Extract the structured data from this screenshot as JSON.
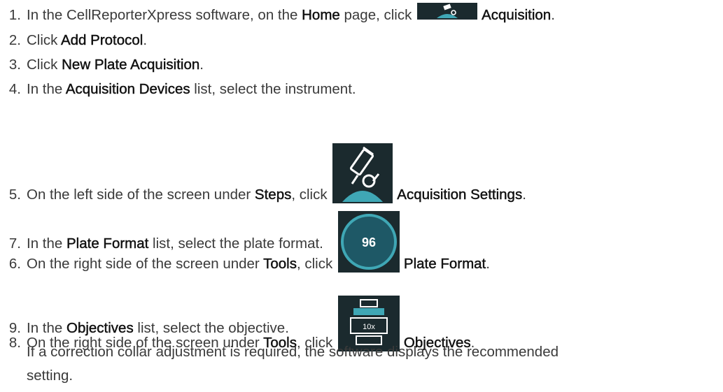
{
  "steps": [
    {
      "num": "1.",
      "pre": "In the CellReporterXpress software, on the ",
      "b1": "Home",
      "mid": " page, click ",
      "b2": "Acquisition",
      "post": ".",
      "icon": "acquisition-icon"
    },
    {
      "num": "2.",
      "pre": "Click ",
      "b1": "Add Protocol",
      "post": "."
    },
    {
      "num": "3.",
      "pre": "Click ",
      "b1": "New Plate Acquisition",
      "post": "."
    },
    {
      "num": "4.",
      "pre": "In the ",
      "b1": "Acquisition Devices",
      "post": " list, select the instrument."
    },
    {
      "num": "5.",
      "pre": "On the left side of the screen under ",
      "b1": "Steps",
      "mid": ", click ",
      "b2": "Acquisition Settings",
      "post": ".",
      "icon": "microscope-icon"
    },
    {
      "num": "6.",
      "pre": "On the right side of the screen under ",
      "b1": "Tools",
      "mid": ", click ",
      "b2": "Plate Format",
      "post": ".",
      "icon": "plate-format-icon",
      "icon_text": "96"
    },
    {
      "num": "7.",
      "pre": "In the ",
      "b1": "Plate Format",
      "post": " list, select the plate format."
    },
    {
      "num": "8.",
      "pre": "On the right side of the screen under ",
      "b1": "Tools",
      "mid": ", click ",
      "b2": "Objectives",
      "post": ".",
      "icon": "objectives-icon",
      "icon_text": "10x"
    },
    {
      "num": "9.",
      "pre": "In the ",
      "b1": "Objectives",
      "post": " list, select the objective."
    }
  ],
  "note": {
    "line1": "If a correction collar adjustment is required, the software displays the recommended",
    "line2": "setting."
  },
  "colors": {
    "text": "#3a3a3a",
    "emphasis": "#111111",
    "icon_bg": "#1b2a2e",
    "icon_accent": "#3fa7b5"
  }
}
